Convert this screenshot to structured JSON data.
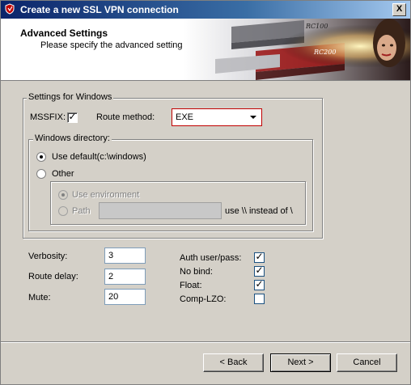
{
  "window": {
    "title": "Create a new SSL VPN connection",
    "close_label": "X"
  },
  "header": {
    "title": "Advanced Settings",
    "subtitle": "Please specify the advanced settings.",
    "art": {
      "label1": "RC100",
      "label2": "RC200"
    }
  },
  "windows_group": {
    "label": "Settings for Windows",
    "mssfix_label": "MSSFIX:",
    "mssfix_checked": true,
    "route_method_label": "Route method:",
    "route_method_value": "EXE",
    "directory": {
      "label": "Windows directory:",
      "use_default_label": "Use default(c:\\windows)",
      "other_label": "Other",
      "use_environment_label": "Use environment",
      "path_label": "Path",
      "path_value": "",
      "path_hint": "use \\\\ instead of \\"
    }
  },
  "fields": {
    "verbosity_label": "Verbosity:",
    "verbosity_value": "3",
    "route_delay_label": "Route delay:",
    "route_delay_value": "2",
    "mute_label": "Mute:",
    "mute_value": "20"
  },
  "flags": {
    "auth_label": "Auth user/pass:",
    "auth_checked": true,
    "nobind_label": "No bind:",
    "nobind_checked": true,
    "float_label": "Float:",
    "float_checked": true,
    "complzo_label": "Comp-LZO:",
    "complzo_checked": false
  },
  "buttons": {
    "back": "< Back",
    "next": "Next >",
    "cancel": "Cancel"
  },
  "colors": {
    "title_bar": "#0a246a",
    "accent_red": "#c00000"
  }
}
